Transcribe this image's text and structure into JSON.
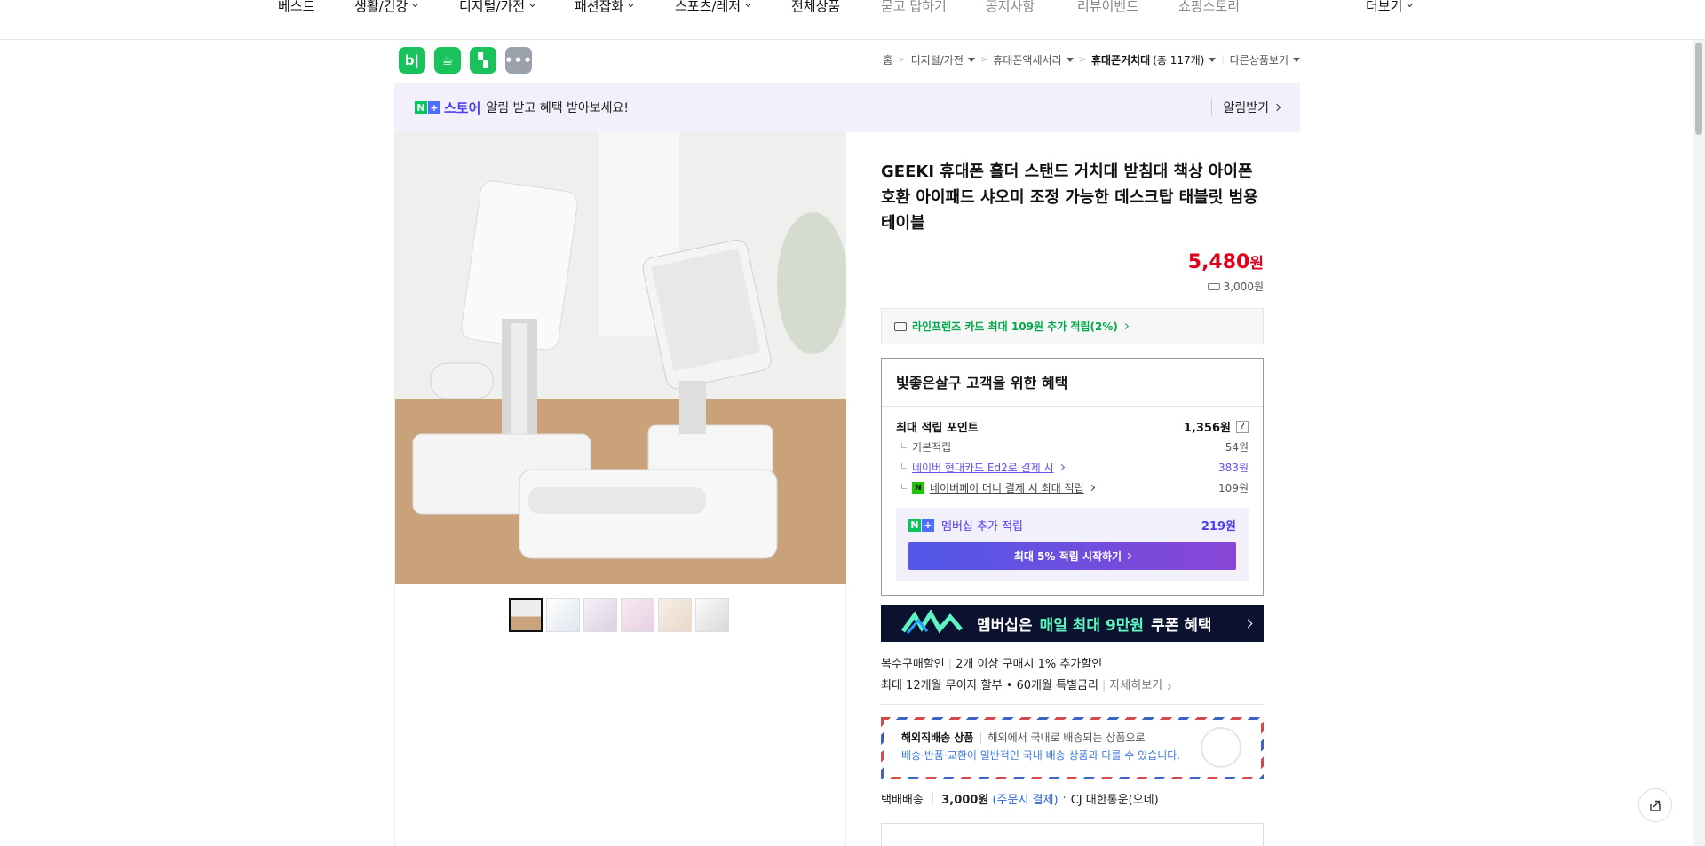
{
  "nav": {
    "items": [
      {
        "label": "베스트",
        "dropdown": false,
        "muted": false
      },
      {
        "label": "생활/건강",
        "dropdown": true,
        "muted": false
      },
      {
        "label": "디지털/가전",
        "dropdown": true,
        "muted": false
      },
      {
        "label": "패션잡화",
        "dropdown": true,
        "muted": false
      },
      {
        "label": "스포츠/레저",
        "dropdown": true,
        "muted": false
      },
      {
        "label": "전체상품",
        "dropdown": false,
        "muted": false
      },
      {
        "label": "묻고 답하기",
        "dropdown": false,
        "muted": true
      },
      {
        "label": "공지사항",
        "dropdown": false,
        "muted": true
      },
      {
        "label": "리뷰이벤트",
        "dropdown": false,
        "muted": true
      },
      {
        "label": "쇼핑스토리",
        "dropdown": false,
        "muted": true
      }
    ],
    "more_label": "더보기"
  },
  "apps": [
    {
      "name": "blog-app-icon",
      "glyph": "b|"
    },
    {
      "name": "cafe-app-icon",
      "glyph": "☕"
    },
    {
      "name": "bookmark-app-icon",
      "glyph": "▚"
    },
    {
      "name": "more-apps-icon",
      "glyph": "•••"
    }
  ],
  "breadcrumb": {
    "home": "홈",
    "cat1": "디지털/가전",
    "cat2": "휴대폰액세서리",
    "cat3": "휴대폰거치대",
    "count": "(총 117개)",
    "other": "다른상품보기"
  },
  "store_banner": {
    "badge_n": "N",
    "badge_plus": "+",
    "store": "스토어",
    "text": "알림 받고 혜택 받아보세요!",
    "notify": "알림받기"
  },
  "product": {
    "title": "GEEKI 휴대폰 홀더 스탠드 거치대 받침대 책상 아이폰 호환 아이패드 샤오미 조정 가능한 데스크탑 태블릿 범용 테이블",
    "price": "5,480",
    "price_unit": "원",
    "shipping_fee": "3,000원",
    "card_offer": "라인프렌즈 카드 최대 109원 추가 적립(2%)"
  },
  "thumbnails": [
    {
      "active": true
    },
    {
      "active": false
    },
    {
      "active": false
    },
    {
      "active": false
    },
    {
      "active": false
    },
    {
      "active": false
    }
  ],
  "benefit": {
    "title": "빛좋은살구 고객을 위한 혜택",
    "max_label": "최대 적립 포인트",
    "max_value": "1,356원",
    "help": "?",
    "rows": [
      {
        "label": "기본적립",
        "value": "54원"
      },
      {
        "label": "네이버 현대카드 Ed2로 결제 시",
        "value": "383원"
      },
      {
        "label": "네이버페이 머니 결제 시 최대 적립",
        "value": "109원"
      }
    ],
    "npay_glyph": "N",
    "member_label": "멤버십 추가 적립",
    "member_value": "219원",
    "start_btn": "최대 5% 적립 시작하기"
  },
  "membership_banner": {
    "text_pre": "멤버십은",
    "highlight": "매일 최대 9만원",
    "text_post": "쿠폰 혜택"
  },
  "discount": {
    "multi_label": "복수구매할인",
    "multi_text": "2개 이상 구매시 1% 추가할인",
    "installment": "최대 12개월 무이자 할부 • 60개월 특별금리",
    "more": "자세히보기"
  },
  "overseas": {
    "label": "해외직배송 상품",
    "desc": "해외에서 국내로 배송되는 상품으로",
    "note": "배송·반품·교환이 일반적인 국내 배송 상품과 다를 수 있습니다."
  },
  "delivery": {
    "type": "택배배송",
    "fee": "3,000원",
    "fee_note": "(주문시 결제)",
    "courier": "CJ 대한통운(오네)"
  },
  "colors": {
    "naver_green": "#03c75a",
    "price_red": "#e0001b",
    "plus_purple": "#4f3df0",
    "banner_bg": "#f2f0fb"
  }
}
